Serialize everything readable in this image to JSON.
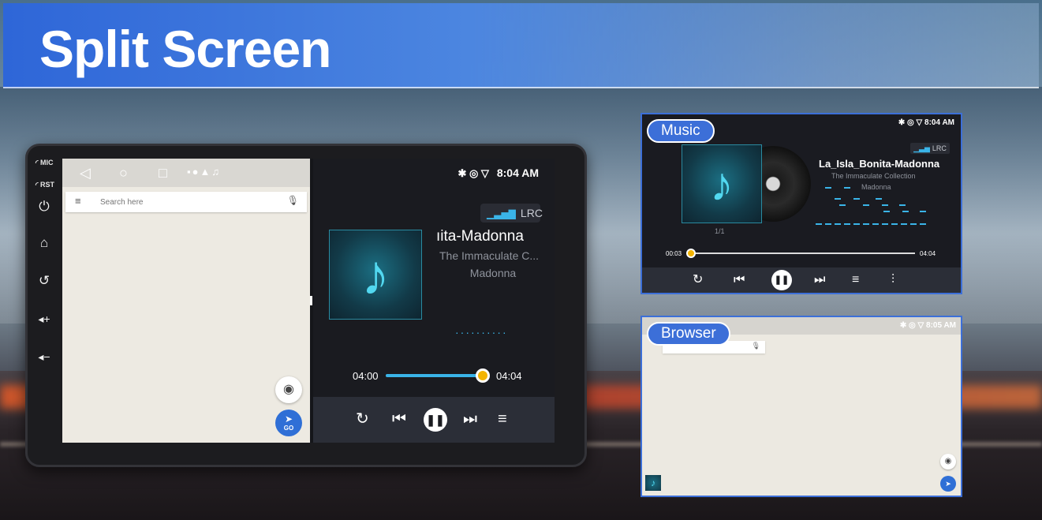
{
  "banner": {
    "title": "Split Screen"
  },
  "head_unit": {
    "mic_label": "MIC",
    "rst_label": "RST",
    "hw_buttons": [
      {
        "icon": "power-icon",
        "glyph": "⏻"
      },
      {
        "icon": "home-icon",
        "glyph": "⌂"
      },
      {
        "icon": "back-icon",
        "glyph": "↺"
      },
      {
        "icon": "volume-up-icon",
        "glyph": "◂+"
      },
      {
        "icon": "volume-down-icon",
        "glyph": "◂−"
      }
    ]
  },
  "map_pane": {
    "search_placeholder": "Search here",
    "go_label": "GO"
  },
  "music_pane": {
    "time": "8:04 AM",
    "lrc_label": "LRC",
    "song_title": "ıita-Madonna",
    "album": "The Immaculate C...",
    "artist": "Madonna",
    "elapsed": "04:00",
    "duration": "04:04",
    "progress": 0.98
  },
  "music_card": {
    "badge": "Music",
    "time": "8:04 AM",
    "lrc_label": "LRC",
    "song_title": "La_Isla_Bonita-Madonna",
    "album": "The Immaculate Collection",
    "artist": "Madonna",
    "page": "1/1",
    "elapsed": "00:03",
    "duration": "04:04",
    "progress": 0.01
  },
  "browser_card": {
    "badge": "Browser",
    "time": "8:05 AM"
  },
  "colors": {
    "accent": "#3ab4e8",
    "badge_blue": "#3c6fd8",
    "knob_yellow": "#f4b400"
  }
}
